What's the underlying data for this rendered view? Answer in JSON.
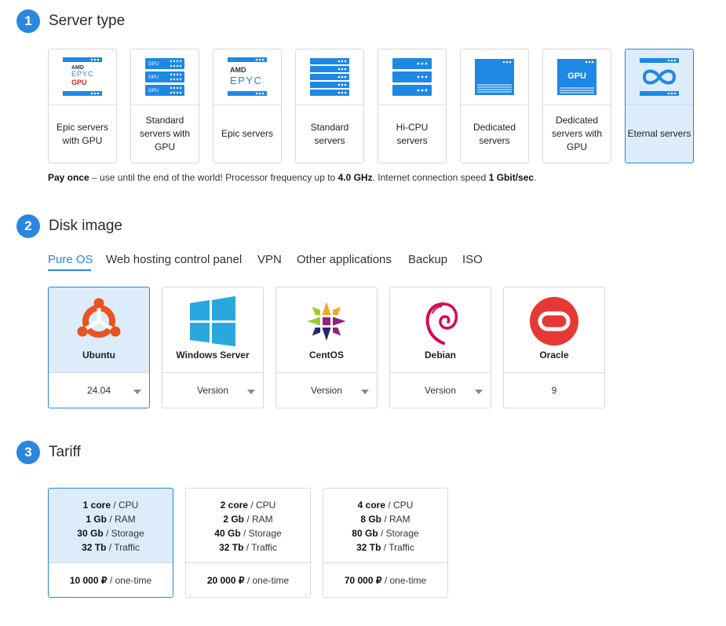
{
  "steps": [
    {
      "number": "1",
      "title": "Server type"
    },
    {
      "number": "2",
      "title": "Disk image"
    },
    {
      "number": "3",
      "title": "Tariff"
    }
  ],
  "server_types": [
    {
      "label": "Epic servers with GPU",
      "icon": "amd-epyc-gpu-icon"
    },
    {
      "label": "Standard servers with GPU",
      "icon": "server-rack-gpu-icon"
    },
    {
      "label": "Epic servers",
      "icon": "amd-epyc-icon"
    },
    {
      "label": "Standard servers",
      "icon": "server-rack-icon"
    },
    {
      "label": "Hi-CPU servers",
      "icon": "server-rack-icon"
    },
    {
      "label": "Dedicated servers",
      "icon": "dedicated-server-icon"
    },
    {
      "label": "Dedicated servers with GPU",
      "icon": "dedicated-gpu-icon"
    },
    {
      "label": "Eternal servers",
      "icon": "infinity-server-icon",
      "selected": true
    }
  ],
  "icon_text": {
    "gpu": "GPU",
    "amd": "AMD",
    "epyc": "EPYC"
  },
  "note": {
    "pay_once": "Pay once",
    "text1": " – use until the end of the world! Processor frequency up to ",
    "freq": "4.0 GHz",
    "text2": ". Internet connection speed ",
    "speed": "1 Gbit/sec",
    "text3": "."
  },
  "disk_tabs": [
    "Pure OS",
    "Web hosting control panel",
    "VPN",
    "Other applications",
    "Backup",
    "ISO"
  ],
  "active_disk_tab": "Pure OS",
  "os_list": [
    {
      "name": "Ubuntu",
      "version": "24.04",
      "dropdown": true,
      "selected": true,
      "icon": "ubuntu-logo-icon"
    },
    {
      "name": "Windows Server",
      "version": "Version",
      "dropdown": true,
      "icon": "windows-logo-icon"
    },
    {
      "name": "CentOS",
      "version": "Version",
      "dropdown": true,
      "icon": "centos-logo-icon"
    },
    {
      "name": "Debian",
      "version": "Version",
      "dropdown": true,
      "icon": "debian-logo-icon"
    },
    {
      "name": "Oracle",
      "version": "9",
      "dropdown": false,
      "icon": "oracle-logo-icon"
    }
  ],
  "tariffs": [
    {
      "core": "1 core",
      "ram": "1 Gb",
      "storage": "30 Gb",
      "traffic": "32 Tb",
      "price": "10 000 ₽",
      "selected": true
    },
    {
      "core": "2 core",
      "ram": "2 Gb",
      "storage": "40 Gb",
      "traffic": "32 Tb",
      "price": "20 000 ₽"
    },
    {
      "core": "4 core",
      "ram": "8 Gb",
      "storage": "80 Gb",
      "traffic": "32 Tb",
      "price": "70 000 ₽"
    }
  ],
  "tariff_units": {
    "cpu": " / CPU",
    "ram": " / RAM",
    "storage": " / Storage",
    "traffic": " / Traffic",
    "price": " / one-time"
  },
  "colors": {
    "accent": "#2b86de",
    "icon_blue": "#1e88e5",
    "selected_bg": "#dcecfb",
    "amd_red": "#c62828",
    "oracle_red": "#e53935"
  }
}
